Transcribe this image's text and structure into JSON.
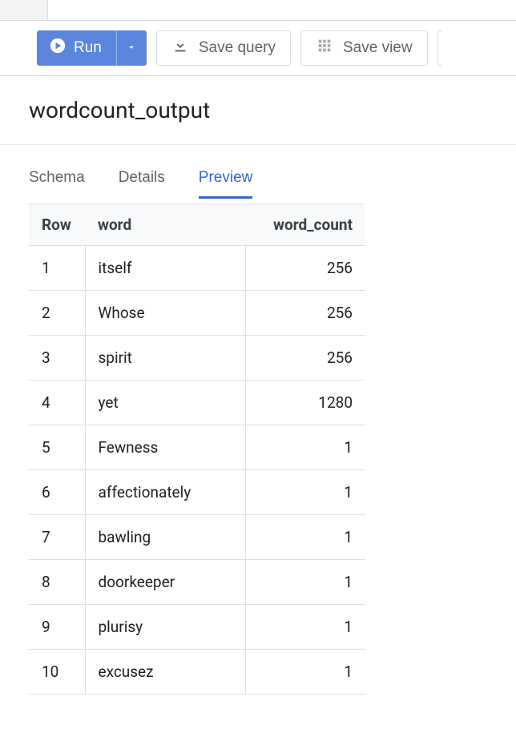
{
  "toolbar": {
    "run_label": "Run",
    "save_query_label": "Save query",
    "save_view_label": "Save view"
  },
  "page_title": "wordcount_output",
  "tabs": {
    "schema": "Schema",
    "details": "Details",
    "preview": "Preview"
  },
  "table": {
    "headers": {
      "row": "Row",
      "word": "word",
      "word_count": "word_count"
    },
    "rows": [
      {
        "n": "1",
        "word": "itself",
        "count": "256"
      },
      {
        "n": "2",
        "word": "Whose",
        "count": "256"
      },
      {
        "n": "3",
        "word": "spirit",
        "count": "256"
      },
      {
        "n": "4",
        "word": "yet",
        "count": "1280"
      },
      {
        "n": "5",
        "word": "Fewness",
        "count": "1"
      },
      {
        "n": "6",
        "word": "affectionately",
        "count": "1"
      },
      {
        "n": "7",
        "word": "bawling",
        "count": "1"
      },
      {
        "n": "8",
        "word": "doorkeeper",
        "count": "1"
      },
      {
        "n": "9",
        "word": "plurisy",
        "count": "1"
      },
      {
        "n": "10",
        "word": "excusez",
        "count": "1"
      }
    ]
  }
}
